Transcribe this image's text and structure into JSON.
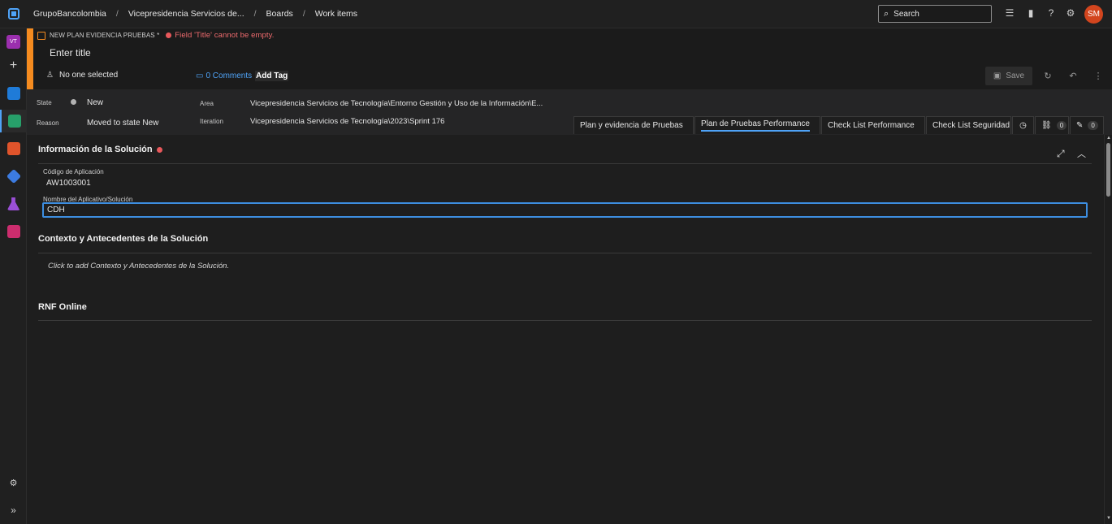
{
  "topbar": {
    "breadcrumbs": [
      "GrupoBancolombia",
      "Vicepresidencia Servicios de...",
      "Boards",
      "Work items"
    ],
    "separator": "/",
    "search_label": "Search",
    "avatar_initials": "SM",
    "avatar_color": "#d2451e",
    "icons": [
      "search-icon",
      "task-list-icon",
      "shopping-bag-icon",
      "help-icon",
      "user-settings-icon"
    ]
  },
  "sidebar": {
    "project_initials": "VT",
    "project_color": "#9b2fae",
    "items": [
      {
        "name": "overview",
        "color": "#1f7bd8"
      },
      {
        "name": "boards",
        "color": "#27a06a"
      },
      {
        "name": "repos",
        "color": "#e0542b"
      },
      {
        "name": "pipelines",
        "color": "#3c7be0"
      },
      {
        "name": "test-plans",
        "color": "#9a4fd6"
      },
      {
        "name": "artifacts",
        "color": "#cc2d6e"
      }
    ],
    "settings_icon": "gear-icon",
    "expand_icon": "double-chevron-icon"
  },
  "header": {
    "work_item_type": "NEW PLAN EVIDENCIA PRUEBAS *",
    "error_message": "Field 'Title' cannot be empty.",
    "title_placeholder": "Enter title",
    "assignee": "No one selected",
    "comments": "0 Comments",
    "add_tag": "Add Tag",
    "save_label": "Save",
    "accent_color": "#f58b1f"
  },
  "fields": {
    "state_label": "State",
    "state_value": "New",
    "reason_label": "Reason",
    "reason_value": "Moved to state New",
    "area_label": "Area",
    "area_value": "Vicepresidencia Servicios de Tecnología\\Entorno Gestión y Uso de la Información\\E...",
    "iteration_label": "Iteration",
    "iteration_value": "Vicepresidencia Servicios de Tecnología\\2023\\Sprint 176"
  },
  "tabs": [
    {
      "label": "Plan y evidencia de Pruebas",
      "error": true
    },
    {
      "label": "Plan de Pruebas Performance",
      "error": true,
      "active": true
    },
    {
      "label": "Check List Performance",
      "error": true
    },
    {
      "label": "Check List Seguridad",
      "error": false
    }
  ],
  "tab_icons": {
    "links_count": "0",
    "attachments_count": "0"
  },
  "content": {
    "section1_title": "Información de la Solución",
    "codigo_label": "Código de Aplicación",
    "codigo_value": "AW1003001",
    "nombre_label": "Nombre del Aplicativo/Solución",
    "nombre_value": "CDH",
    "section2_title": "Contexto y Antecedentes de la Solución",
    "section2_placeholder": "Click to add Contexto y Antecedentes de la Solución.",
    "section3_title": "RNF Online"
  }
}
